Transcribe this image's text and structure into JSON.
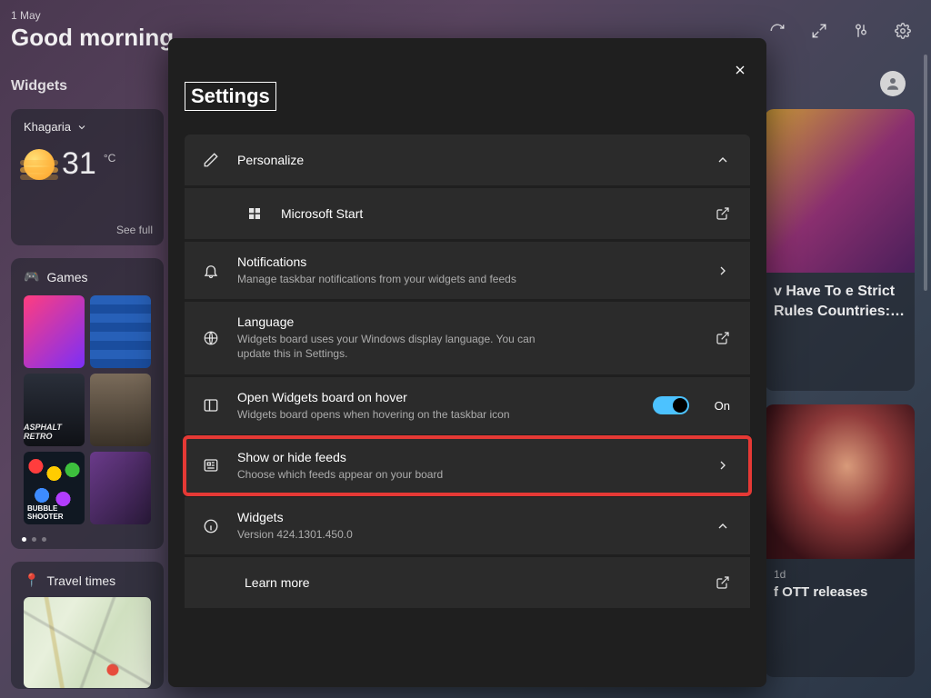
{
  "header": {
    "date": "1 May",
    "greeting": "Good morning",
    "widgets_label": "Widgets"
  },
  "weather": {
    "location": "Khagaria",
    "temp": "31",
    "unit": "°C",
    "see_full": "See full"
  },
  "games": {
    "title": "Games",
    "tile3": "ASPHALT RETRO",
    "tile5": "BUBBLE SHOOTER"
  },
  "travel": {
    "title": "Travel times"
  },
  "news1": {
    "headline": "v Have To e Strict Rules Countries:…"
  },
  "news2": {
    "meta": "1d",
    "headline": "f OTT releases"
  },
  "modal": {
    "title": "Settings",
    "personalize": {
      "title": "Personalize",
      "ms_start": "Microsoft Start"
    },
    "notifications": {
      "title": "Notifications",
      "sub": "Manage taskbar notifications from your widgets and feeds"
    },
    "language": {
      "title": "Language",
      "sub": "Widgets board uses your Windows display language. You can update this in Settings."
    },
    "hover": {
      "title": "Open Widgets board on hover",
      "sub": "Widgets board opens when hovering on the taskbar icon",
      "state": "On"
    },
    "feeds": {
      "title": "Show or hide feeds",
      "sub": "Choose which feeds appear on your board"
    },
    "widgets": {
      "title": "Widgets",
      "sub": "Version 424.1301.450.0"
    },
    "learn_more": "Learn more"
  }
}
